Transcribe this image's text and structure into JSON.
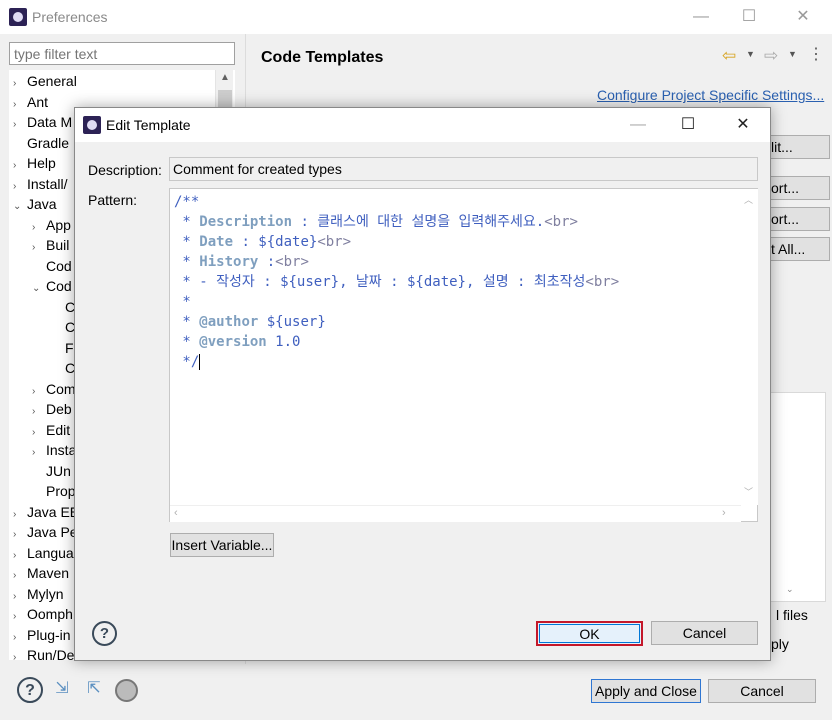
{
  "window": {
    "title": "Preferences",
    "minimize_glyph": "—",
    "maximize_glyph": "☐",
    "close_glyph": "✕"
  },
  "filter": {
    "placeholder": "type filter text"
  },
  "tree": {
    "items": [
      {
        "label": "General",
        "arrow": "›"
      },
      {
        "label": "Ant",
        "arrow": "›"
      },
      {
        "label": "Data M",
        "arrow": "›"
      },
      {
        "label": "Gradle",
        "arrow": ""
      },
      {
        "label": "Help",
        "arrow": "›"
      },
      {
        "label": "Install/",
        "arrow": "›"
      },
      {
        "label": "Java",
        "arrow": "⌄"
      },
      {
        "label": "App",
        "arrow": "›"
      },
      {
        "label": "Buil",
        "arrow": "›"
      },
      {
        "label": "Cod",
        "arrow": ""
      },
      {
        "label": "Cod",
        "arrow": "⌄"
      },
      {
        "label": "C",
        "arrow": ""
      },
      {
        "label": "C",
        "arrow": ""
      },
      {
        "label": "F",
        "arrow": ""
      },
      {
        "label": "C",
        "arrow": ""
      },
      {
        "label": "Com",
        "arrow": "›"
      },
      {
        "label": "Deb",
        "arrow": "›"
      },
      {
        "label": "Edit",
        "arrow": "›"
      },
      {
        "label": "Insta",
        "arrow": "›"
      },
      {
        "label": "JUn",
        "arrow": ""
      },
      {
        "label": "Prop",
        "arrow": ""
      },
      {
        "label": "Java EE",
        "arrow": "›"
      },
      {
        "label": "Java Pe",
        "arrow": "›"
      },
      {
        "label": "Langua",
        "arrow": "›"
      },
      {
        "label": "Maven",
        "arrow": "›"
      },
      {
        "label": "Mylyn",
        "arrow": "›"
      },
      {
        "label": "Oomph",
        "arrow": "›"
      },
      {
        "label": "Plug-in",
        "arrow": "›"
      },
      {
        "label": "Run/De",
        "arrow": "›"
      }
    ],
    "scroll_up_glyph": "▲"
  },
  "page": {
    "title": "Code Templates",
    "configure_link": "Configure Project Specific Settings...",
    "nav_back_glyph": "⇦",
    "nav_fwd_glyph": "⇨",
    "nav_dropdown_glyph": "▼",
    "nav_menu_glyph": "⋮",
    "side_buttons": [
      "lit...",
      "ort...",
      "ort...",
      "t All..."
    ],
    "files_label": "l files",
    "apply_label": "ply",
    "preview_scroll_glyph": "⌄"
  },
  "bottom": {
    "help_glyph": "?",
    "import_glyph": "⇲",
    "export_glyph": "⇱",
    "apply_close": "Apply and Close",
    "cancel": "Cancel"
  },
  "dialog": {
    "title": "Edit Template",
    "minimize_glyph": "—",
    "maximize_glyph": "☐",
    "close_glyph": "✕",
    "description_label": "Description:",
    "description_value": "Comment for created types",
    "pattern_label": "Pattern:",
    "pattern_lines": {
      "l1": "/**",
      "l2_prefix": " * ",
      "l2_kw": "Description",
      "l2_text": " : 클래스에 대한 설명을 입력해주세요.",
      "l2_tag": "<br>",
      "l3_prefix": " * ",
      "l3_kw": "Date",
      "l3_text": " : ${date}",
      "l3_tag": "<br>",
      "l4_prefix": " * ",
      "l4_kw": "History",
      "l4_text": " :",
      "l4_tag": "<br>",
      "l5_text": " * - 작성자 : ${user}, 날짜 : ${date}, 설명 : 최초작성",
      "l5_tag": "<br>",
      "l6": " *",
      "l7_prefix": " * ",
      "l7_kw": "@author",
      "l7_text": " ${user}",
      "l8_prefix": " * ",
      "l8_kw": "@version",
      "l8_text": " 1.0",
      "l9": " */"
    },
    "scroll_up_glyph": "︿",
    "scroll_down_glyph": "﹀",
    "scroll_left_glyph": "‹",
    "scroll_right_glyph": "›",
    "insert_variable": "Insert Variable...",
    "help_glyph": "?",
    "ok": "OK",
    "cancel": "Cancel"
  },
  "colors": {
    "ok_highlight": "#c4182a",
    "link": "#2a60b0",
    "javadoc": "#3f5fbf",
    "javadoc_keyword": "#7f9fbf"
  }
}
